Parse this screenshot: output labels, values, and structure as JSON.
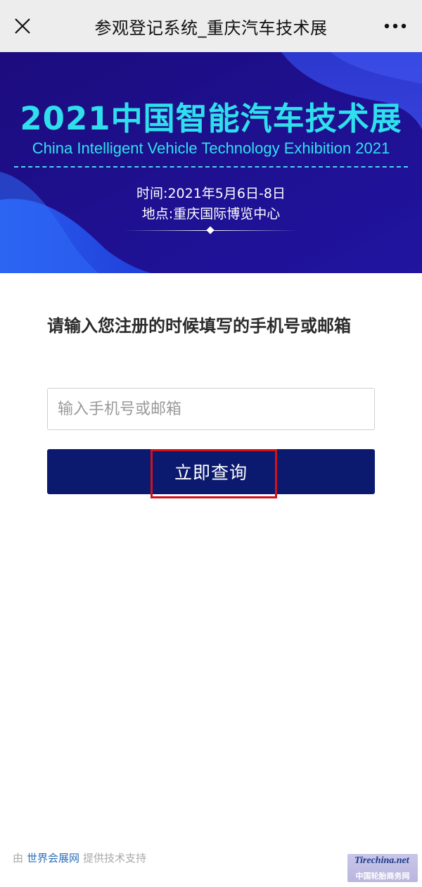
{
  "header": {
    "title": "参观登记系统_重庆汽车技术展",
    "close_icon": "close-icon",
    "more_icon": "more-dots-icon"
  },
  "banner": {
    "title": "2021中国智能汽车技术展",
    "subtitle": "China Intelligent Vehicle Technology Exhibition 2021",
    "time": "时间:2021年5月6日-8日",
    "place": "地点:重庆国际博览中心",
    "colors": {
      "background": "#1a0f86",
      "title": "#2fe0ec",
      "accent": "#2b5ee8"
    }
  },
  "form": {
    "prompt": "请输入您注册的时候填写的手机号或邮箱",
    "input_placeholder": "输入手机号或邮箱",
    "input_value": "",
    "submit_label": "立即查询",
    "submit_color": "#0b1a6e",
    "highlight_color": "#d0121b"
  },
  "footer": {
    "prefix": "由",
    "link": "世界会展网",
    "suffix": "提供技术支持"
  },
  "watermark": {
    "logo_text": "Tirechina.net",
    "text": "中国轮胎商务网"
  }
}
